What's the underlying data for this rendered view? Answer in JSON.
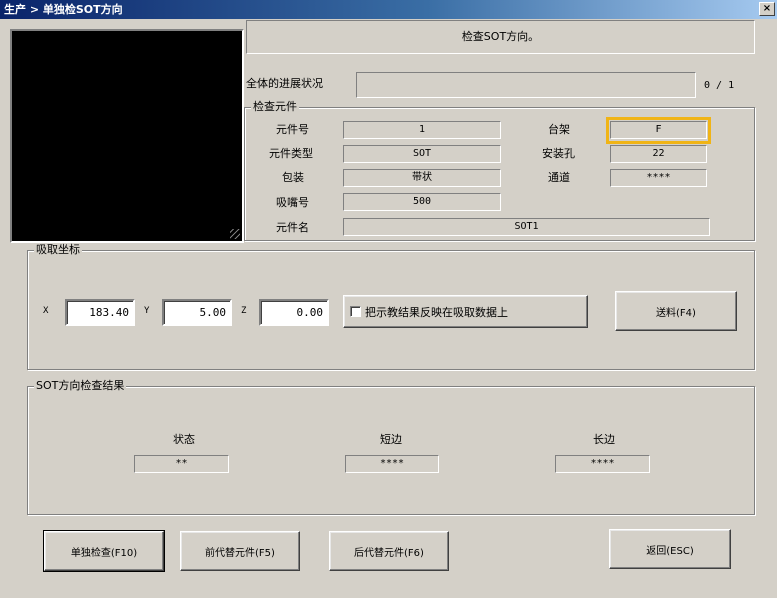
{
  "window": {
    "title": "生产 > 单独检SOT方向",
    "close_label": "×"
  },
  "message": "检查SOT方向。",
  "progress": {
    "label": "全体的进展状况",
    "value_text": "0 / 1",
    "fraction": 0
  },
  "inspect_group": {
    "title": "检查元件",
    "part_no_label": "元件号",
    "part_no": "1",
    "part_type_label": "元件类型",
    "part_type": "SOT",
    "package_label": "包装",
    "package": "带状",
    "nozzle_label": "吸嘴号",
    "nozzle": "500",
    "part_name_label": "元件名",
    "part_name": "SOT1",
    "rack_label": "台架",
    "rack": "F",
    "hole_label": "安装孔",
    "hole": "22",
    "channel_label": "通道",
    "channel": "****"
  },
  "pick_group": {
    "title": "吸取坐标",
    "x_label": "X",
    "x_value": "183.40",
    "y_label": "Y",
    "y_value": "5.00",
    "z_label": "Z",
    "z_value": "0.00",
    "checkbox_label": "把示教结果反映在吸取数据上",
    "feed_button": "送料(F4)"
  },
  "result_group": {
    "title": "SOT方向检查结果",
    "status_label": "状态",
    "status_value": "**",
    "short_label": "短边",
    "short_value": "****",
    "long_label": "长边",
    "long_value": "****"
  },
  "buttons": {
    "single_check": "单独检查(F10)",
    "prev_part": "前代替元件(F5)",
    "next_part": "后代替元件(F6)",
    "back": "返回(ESC)"
  },
  "colors": {
    "highlight": "#f0b416",
    "titlebar": "#0a246a",
    "camera": "#000000"
  }
}
